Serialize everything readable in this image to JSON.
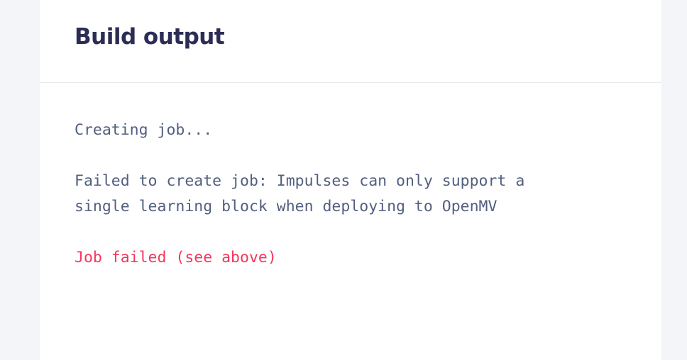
{
  "panel": {
    "title": "Build output"
  },
  "console": {
    "lines": [
      {
        "text": "Creating job...",
        "type": "info"
      },
      {
        "text": "",
        "type": "blank"
      },
      {
        "text": "Failed to create job: Impulses can only support a",
        "type": "info"
      },
      {
        "text": "single learning block when deploying to OpenMV",
        "type": "info"
      },
      {
        "text": "",
        "type": "blank"
      },
      {
        "text": "Job failed (see above)",
        "type": "error"
      }
    ]
  },
  "colors": {
    "title": "#2b2d55",
    "text": "#525f7f",
    "error": "#f5365c",
    "background": "#f4f5f9",
    "card": "#ffffff"
  }
}
